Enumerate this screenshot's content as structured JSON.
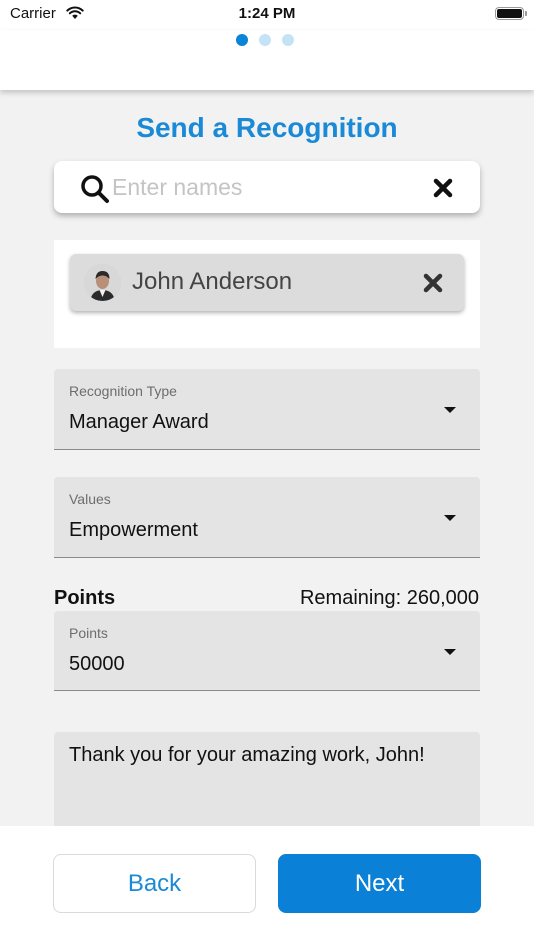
{
  "status_bar": {
    "carrier": "Carrier",
    "time": "1:24 PM"
  },
  "stepper": {
    "steps": 3,
    "current": 1
  },
  "page": {
    "title": "Send a Recognition"
  },
  "search": {
    "placeholder": "Enter names",
    "value": ""
  },
  "recipients": [
    {
      "name": "John Anderson"
    }
  ],
  "recognition_type": {
    "label": "Recognition Type",
    "value": "Manager Award"
  },
  "values_field": {
    "label": "Values",
    "value": "Empowerment"
  },
  "points": {
    "heading": "Points",
    "remaining": "Remaining: 260,000",
    "label": "Points",
    "value": "50000"
  },
  "message": {
    "text": "Thank you for your amazing work, John!"
  },
  "buttons": {
    "back": "Back",
    "next": "Next"
  },
  "colors": {
    "accent": "#1a8ad6",
    "primary_button": "#0a80d6",
    "dot_inactive": "#c4e3f6"
  }
}
